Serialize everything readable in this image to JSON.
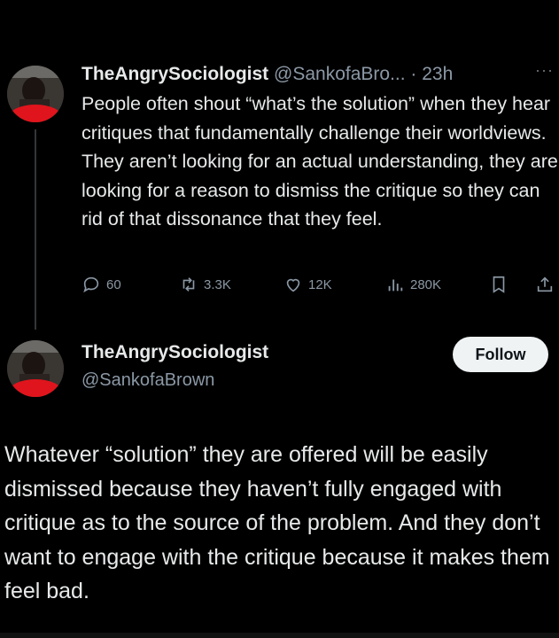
{
  "tweet1": {
    "display_name": "TheAngrySociologist",
    "handle_time": "@SankofaBro... · 23h",
    "more": "···",
    "text": "People often shout “what’s the solution” when they hear critiques that fundamentally challenge their worldviews. They aren’t looking for an actual understanding, they are looking for a reason to dismiss the critique so they can rid of that dissonance that they feel.",
    "actions": {
      "replies": "60",
      "reposts": "3.3K",
      "likes": "12K",
      "views": "280K"
    }
  },
  "tweet2": {
    "display_name": "TheAngrySociologist",
    "handle": "@SankofaBrown",
    "follow_label": "Follow",
    "text": "Whatever “solution” they are offered will be easily dismissed because they haven’t fully engaged with critique as to the source of the problem. And they don’t want to engage with the critique because it makes them feel bad."
  },
  "icons": {
    "reply": "reply-icon",
    "repost": "repost-icon",
    "like": "heart-icon",
    "views": "views-icon",
    "bookmark": "bookmark-icon",
    "share": "share-icon"
  },
  "colors": {
    "background": "#000000",
    "text": "#e7e9ea",
    "muted": "#8b98a5",
    "follow_bg": "#eff3f4"
  }
}
